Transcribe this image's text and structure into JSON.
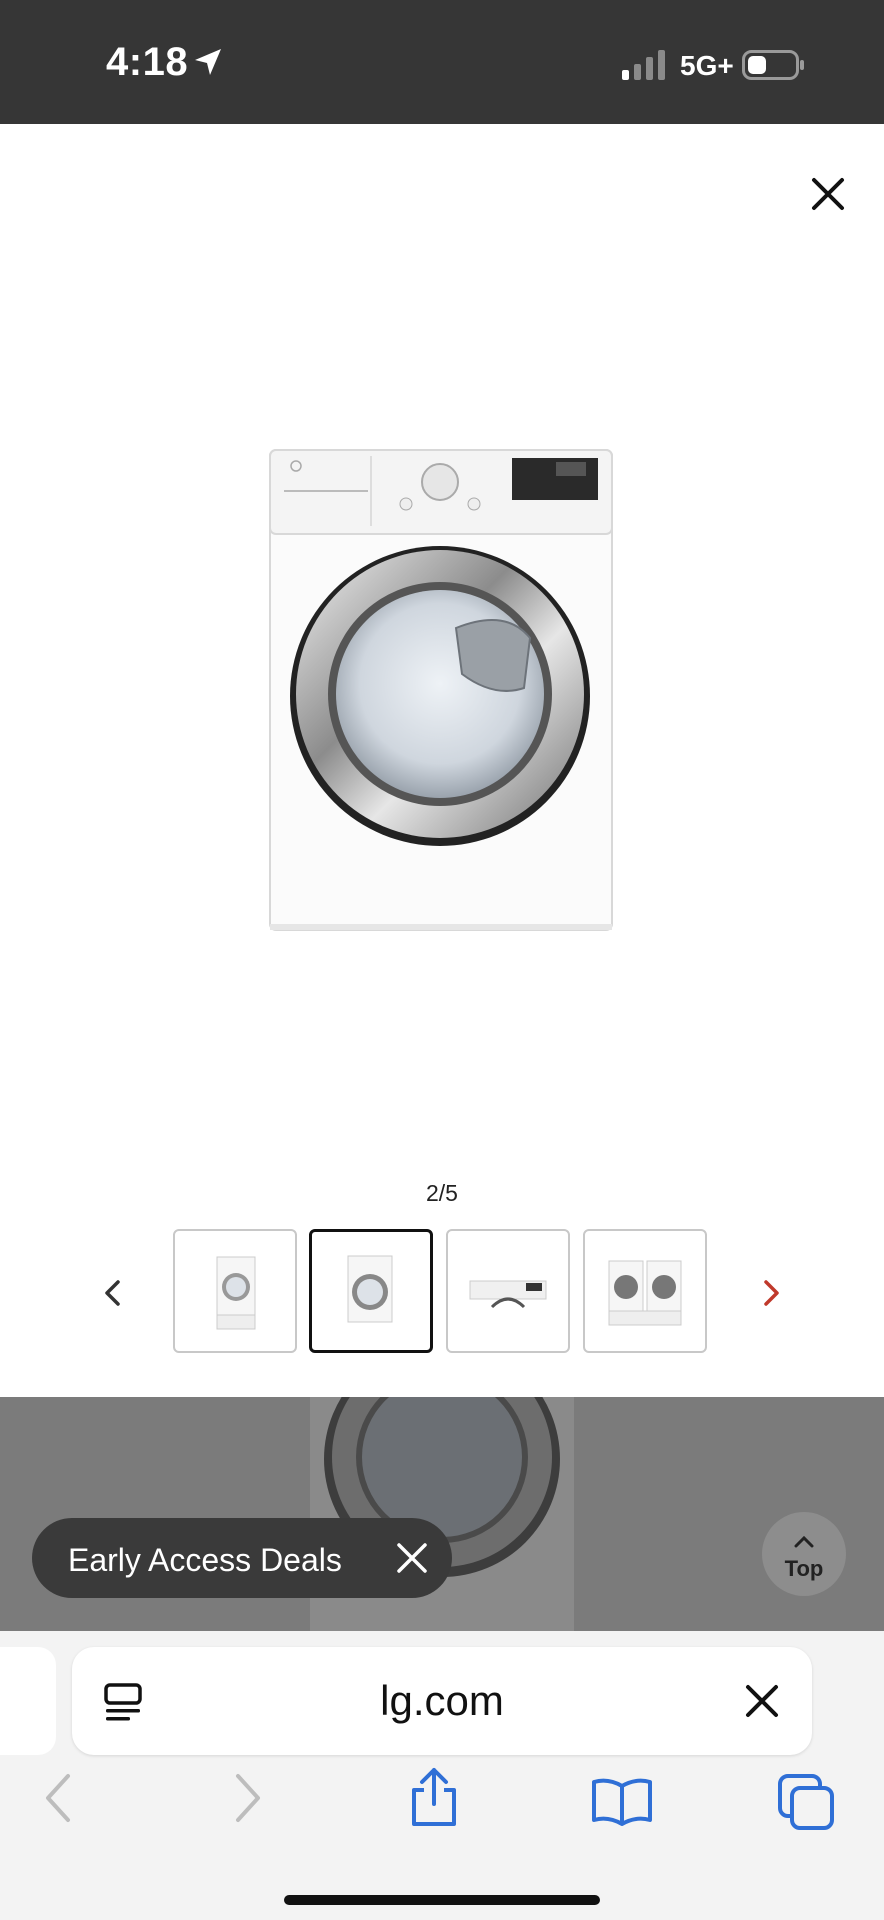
{
  "status": {
    "time": "4:18",
    "network": "5G+"
  },
  "viewer": {
    "counter": "2/5",
    "thumbnails": [
      "thumb-1",
      "thumb-2",
      "thumb-3",
      "thumb-4"
    ],
    "active_index": 1,
    "accent": "#c0392b"
  },
  "promo": {
    "label": "Early Access Deals"
  },
  "top_button": {
    "label": "Top"
  },
  "browser": {
    "url": "lg.com",
    "accent": "#2f6fd6"
  },
  "icons": [
    "location-arrow-icon",
    "signal-icon",
    "battery-icon",
    "close-icon",
    "chevron-left-icon",
    "chevron-right-icon",
    "reader-icon",
    "share-icon",
    "bookmarks-icon",
    "tabs-icon"
  ]
}
